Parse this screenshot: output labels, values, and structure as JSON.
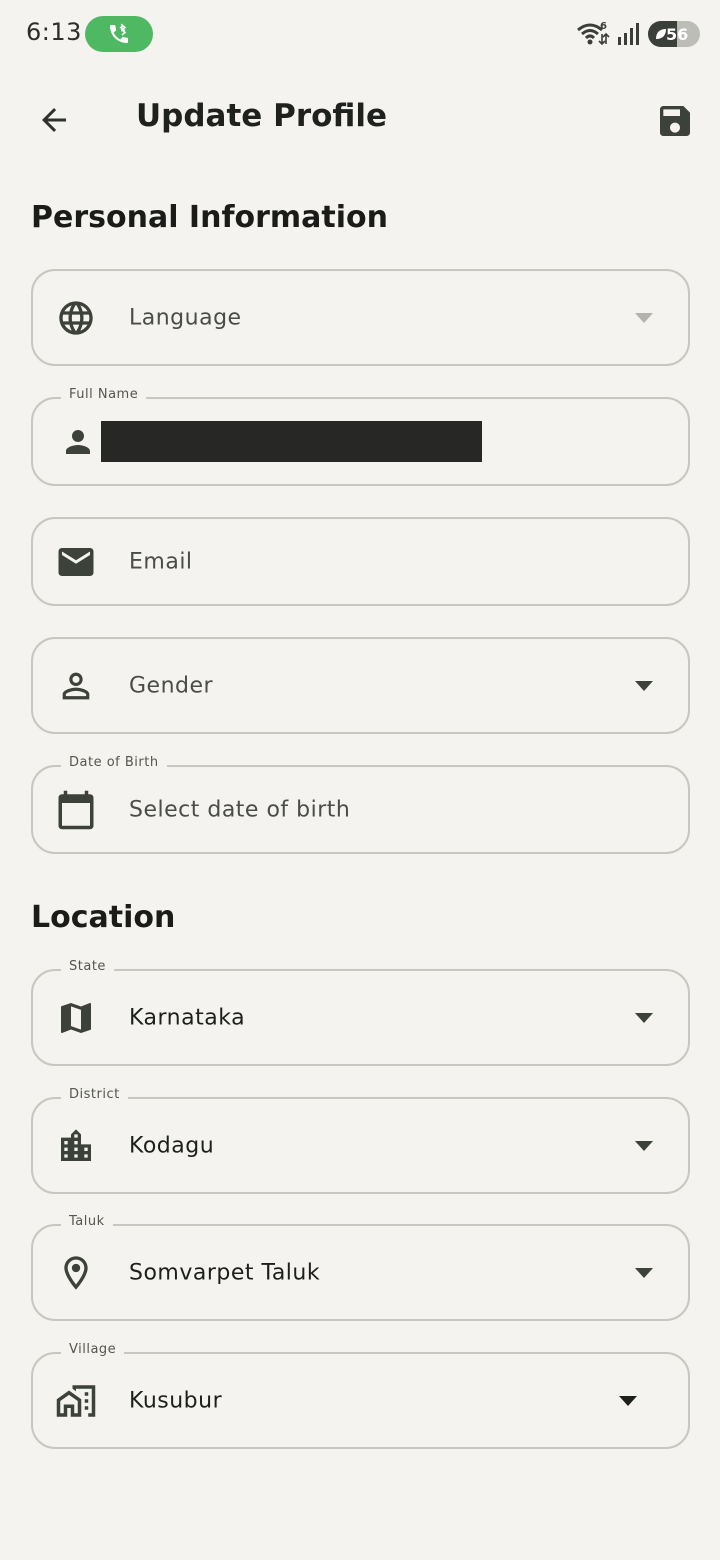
{
  "status_bar": {
    "time": "6:13",
    "battery": "56",
    "network_label": "6"
  },
  "header": {
    "title": "Update Profile"
  },
  "personal": {
    "section_title": "Personal Information",
    "language": {
      "placeholder": "Language",
      "icon": "globe-icon"
    },
    "full_name": {
      "label": "Full Name",
      "icon": "person-icon"
    },
    "email": {
      "placeholder": "Email",
      "icon": "mail-icon"
    },
    "gender": {
      "placeholder": "Gender",
      "icon": "person-outline-icon"
    },
    "dob": {
      "label": "Date of Birth",
      "placeholder": "Select date of birth",
      "icon": "calendar-icon"
    }
  },
  "location": {
    "section_title": "Location",
    "state": {
      "label": "State",
      "value": "Karnataka",
      "icon": "map-icon"
    },
    "district": {
      "label": "District",
      "value": "Kodagu",
      "icon": "city-icon"
    },
    "taluk": {
      "label": "Taluk",
      "value": "Somvarpet Taluk",
      "icon": "location-pin-icon"
    },
    "village": {
      "label": "Village",
      "value": "Kusubur",
      "icon": "village-icon"
    }
  },
  "colors": {
    "background": "#f4f3ef",
    "border": "#c7c7c1",
    "icon": "#3c4139",
    "call_pill": "#4fb862"
  }
}
